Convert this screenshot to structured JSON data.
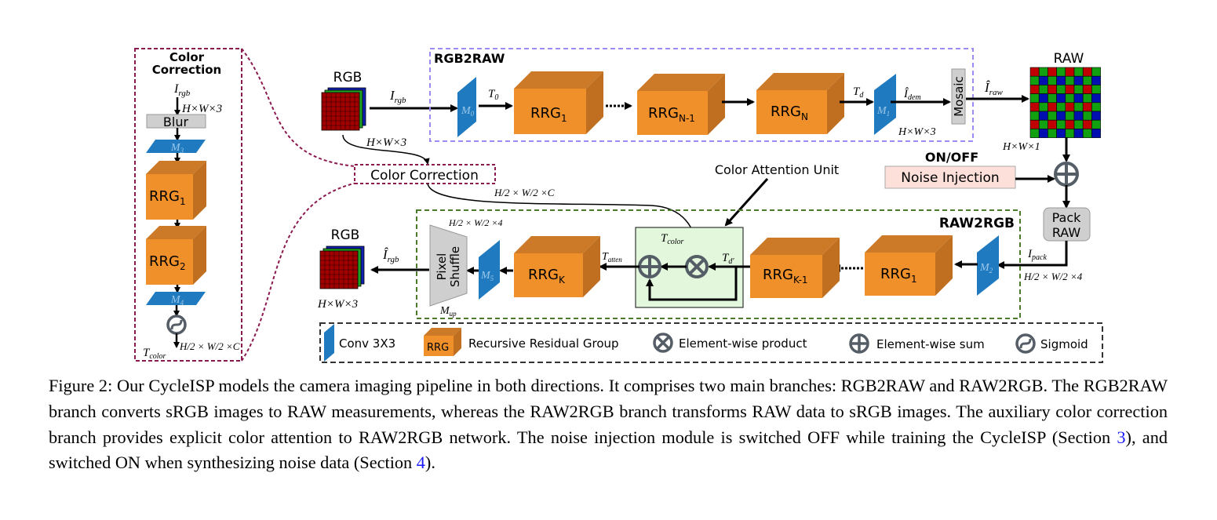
{
  "colors": {
    "rrg_orange": "#f0902a",
    "conv_blue": "#1f7abf",
    "rgb2raw_border": "#9a8cf0",
    "raw2rgb_border": "#4a7a2a",
    "color_correction_border": "#8c1a50",
    "noise_fill": "#fde0d9",
    "attention_fill": "#e2f7dc",
    "link_blue": "#1a1aff"
  },
  "color_correction_panel": {
    "title_line1": "Color",
    "title_line2": "Correction",
    "input": {
      "main": "I",
      "sub": "rgb"
    },
    "input_dim": "H×W×3",
    "blur": "Blur",
    "conv_top": {
      "main": "M",
      "sub": "3"
    },
    "rrg1": {
      "main": "RRG",
      "sub": "1"
    },
    "rrg2": {
      "main": "RRG",
      "sub": "2"
    },
    "conv_bottom": {
      "main": "M",
      "sub": "4"
    },
    "output": {
      "main": "T",
      "sub": "color"
    },
    "output_dim": "H/2 × W/2 ×C"
  },
  "input_rgb": {
    "label": "RGB",
    "dim": "H×W×3",
    "arrow_label": {
      "main": "I",
      "sub": "rgb"
    }
  },
  "color_correction_node": {
    "label": "Color Correction",
    "out_dim": "H/2 × W/2 ×C"
  },
  "rgb2raw": {
    "title": "RGB2RAW",
    "conv_in": {
      "main": "M",
      "sub": "0"
    },
    "t0": {
      "main": "T",
      "sub": "0"
    },
    "rrg1": {
      "main": "RRG",
      "sub": "1"
    },
    "rrg_n1": {
      "main": "RRG",
      "sub": "N-1"
    },
    "rrg_n": {
      "main": "RRG",
      "sub": "N"
    },
    "td": {
      "main": "T",
      "sub": "d"
    },
    "conv_out": {
      "main": "M",
      "sub": "1"
    },
    "idem": {
      "main": "Î",
      "sub": "dem"
    },
    "dim": "H×W×3",
    "mosaic": "Mosaic",
    "iraw": {
      "main": "Î",
      "sub": "raw"
    }
  },
  "raw": {
    "label": "RAW",
    "dim": "H×W×1"
  },
  "noise": {
    "switch": "ON/OFF",
    "label": "Noise Injection"
  },
  "pack_raw": {
    "line1": "Pack",
    "line2": "RAW",
    "ipack": {
      "main": "I",
      "sub": "pack"
    },
    "dim": "H/2 × W/2 ×4"
  },
  "raw2rgb": {
    "title": "RAW2RGB",
    "conv_in": {
      "main": "M",
      "sub": "2"
    },
    "rrg1": {
      "main": "RRG",
      "sub": "1"
    },
    "rrg_k1": {
      "main": "RRG",
      "sub": "K-1"
    },
    "rrg_k": {
      "main": "RRG",
      "sub": "K"
    },
    "tcolor": {
      "main": "T",
      "sub": "color"
    },
    "tdp": {
      "main": "T",
      "sub": "d′"
    },
    "tatten": {
      "main": "T",
      "sub": "atten"
    },
    "conv_out": {
      "main": "M",
      "sub": "5"
    },
    "shuffle_line1": "Pixel",
    "shuffle_line2": "Shuffle",
    "mup": {
      "main": "M",
      "sub": "up"
    },
    "shuffle_dim": "H/2 × W/2 ×4",
    "irgb": {
      "main": "Î",
      "sub": "rgb"
    }
  },
  "attention_label": "Color Attention Unit",
  "output_rgb": {
    "label": "RGB",
    "dim": "H×W×3"
  },
  "legend": {
    "conv": "Conv 3X3",
    "rrg_icon": "RRG",
    "rrg": "Recursive Residual Group",
    "product": "Element-wise product",
    "sum": "Element-wise sum",
    "sigmoid": "Sigmoid"
  },
  "caption": {
    "p1": "Figure 2: Our CycleISP models the camera imaging pipeline in both directions. It comprises two main branches: RGB2RAW and RAW2RGB. The RGB2RAW branch converts sRGB images to RAW measurements, whereas the RAW2RGB branch transforms RAW data to sRGB images. The auxiliary color correction branch provides explicit color attention to RAW2RGB network.  The noise injection module is switched OFF while training the CycleISP (Section ",
    "ref1": "3",
    "p2": "), and switched ON when synthesizing noise data (Section ",
    "ref2": "4",
    "p3": ")."
  }
}
